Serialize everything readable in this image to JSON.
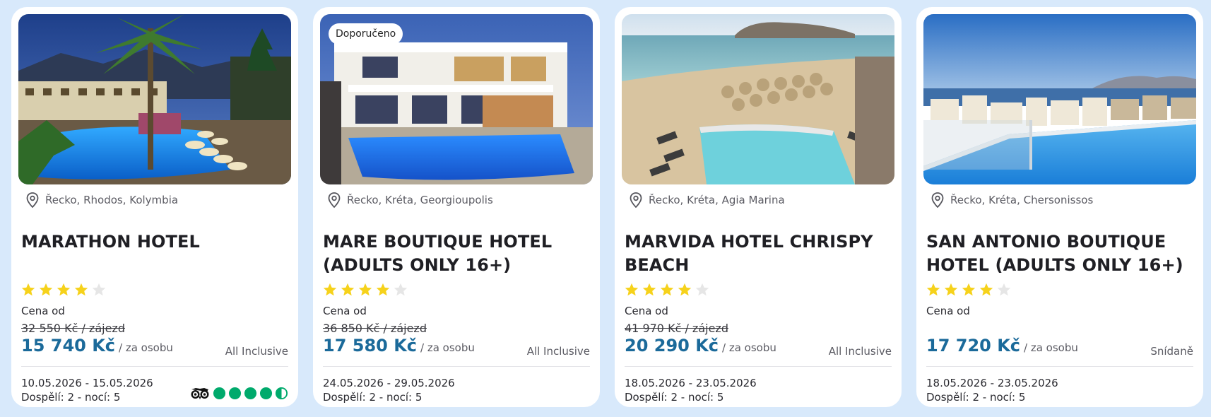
{
  "colors": {
    "background": "#d8e9fb",
    "price": "#1b6a9a",
    "star_filled": "#f6d21b",
    "star_empty": "#e6e6e6",
    "tripadvisor": "#00aa6c"
  },
  "icons": {
    "location": "map-pin-icon",
    "star": "star-icon",
    "tripadvisor": "tripadvisor-owl-icon",
    "rating_bubble": "rating-bubble-icon"
  },
  "hotels": [
    {
      "image": "hotel photo with palm trees and illuminated pool at night",
      "badge": "",
      "location": "Řecko, Rhodos, Kolymbia",
      "name": "MARATHON HOTEL",
      "stars": 4,
      "stars_max": 5,
      "price_from_label": "Cena od",
      "old_price": "32 550 Kč / zájezd",
      "price": "15 740 Kč",
      "price_unit": "/ za osobu",
      "board": "All Inclusive",
      "dates": "10.05.2026 - 15.05.2026",
      "pax": "Dospělí: 2 - nocí: 5",
      "tripadvisor_rating": 4.5
    },
    {
      "image": "white hotel building with pool at dusk",
      "badge": "Doporučeno",
      "location": "Řecko, Kréta, Georgioupolis",
      "name": "MARE BOUTIQUE HOTEL (ADULTS ONLY 16+)",
      "stars": 4,
      "stars_max": 5,
      "price_from_label": "Cena od",
      "old_price": "36 850 Kč / zájezd",
      "price": "17 580 Kč",
      "price_unit": "/ za osobu",
      "board": "All Inclusive",
      "dates": "24.05.2026 - 29.05.2026",
      "pax": "Dospělí: 2 - nocí: 5",
      "tripadvisor_rating": null
    },
    {
      "image": "beach with parasols, sea and island, hotel pool in foreground",
      "badge": "",
      "location": "Řecko, Kréta, Agia Marina",
      "name": "MARVIDA HOTEL CHRISPY BEACH",
      "stars": 4,
      "stars_max": 5,
      "price_from_label": "Cena od",
      "old_price": "41 970 Kč / zájezd",
      "price": "20 290 Kč",
      "price_unit": "/ za osobu",
      "board": "All Inclusive",
      "dates": "18.05.2026 - 23.05.2026",
      "pax": "Dospělí: 2 - nocí: 5",
      "tripadvisor_rating": null
    },
    {
      "image": "rooftop infinity pool overlooking town, sea and mountains",
      "badge": "",
      "location": "Řecko, Kréta, Chersonissos",
      "name": "SAN ANTONIO BOUTIQUE HOTEL (ADULTS ONLY 16+)",
      "stars": 4,
      "stars_max": 5,
      "price_from_label": "Cena od",
      "old_price": "",
      "price": "17 720 Kč",
      "price_unit": "/ za osobu",
      "board": "Snídaně",
      "dates": "18.05.2026 - 23.05.2026",
      "pax": "Dospělí: 2 - nocí: 5",
      "tripadvisor_rating": null
    }
  ]
}
